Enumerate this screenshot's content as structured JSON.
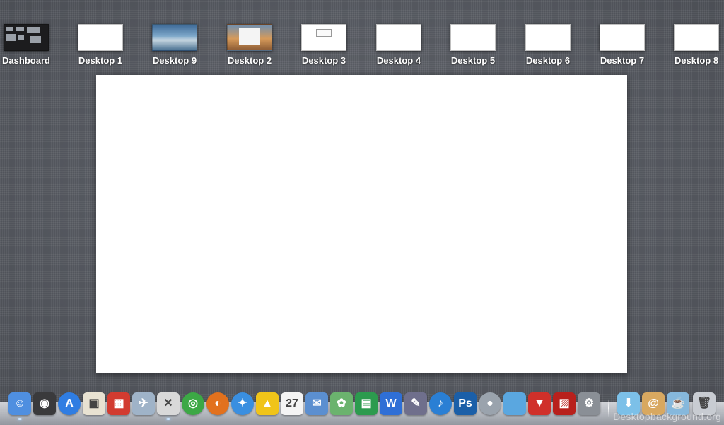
{
  "spaces": [
    {
      "label": "Dashboard",
      "kind": "dashboard"
    },
    {
      "label": "Desktop 1",
      "kind": "blank"
    },
    {
      "label": "Desktop 9",
      "kind": "sea-wallpaper"
    },
    {
      "label": "Desktop 2",
      "kind": "sunset-wallpaper-with-window"
    },
    {
      "label": "Desktop 3",
      "kind": "blank-with-window"
    },
    {
      "label": "Desktop 4",
      "kind": "blank"
    },
    {
      "label": "Desktop 5",
      "kind": "blank"
    },
    {
      "label": "Desktop 6",
      "kind": "blank"
    },
    {
      "label": "Desktop 7",
      "kind": "blank"
    },
    {
      "label": "Desktop 8",
      "kind": "blank"
    }
  ],
  "dock": {
    "apps": [
      {
        "icon": "finder-icon",
        "glyph": "☺",
        "color": "#4f8fe0"
      },
      {
        "icon": "dashboard-icon",
        "glyph": "◉",
        "color": "#3a3a3c"
      },
      {
        "icon": "app-store-icon",
        "glyph": "A",
        "color": "#2f7de2"
      },
      {
        "icon": "preview-icon",
        "glyph": "▣",
        "color": "#e8e2d2"
      },
      {
        "icon": "vmware-icon",
        "glyph": "▦",
        "color": "#d23b30"
      },
      {
        "icon": "network-icon",
        "glyph": "✈",
        "color": "#9fb3c8"
      },
      {
        "icon": "photo-booth-icon",
        "glyph": "✕",
        "color": "#d9d9d9"
      },
      {
        "icon": "chrome-icon",
        "glyph": "◎",
        "color": "#3ca845"
      },
      {
        "icon": "firefox-icon",
        "glyph": "◐",
        "color": "#e2711d"
      },
      {
        "icon": "safari-icon",
        "glyph": "✦",
        "color": "#3a8fe0"
      },
      {
        "icon": "twitter-client-icon",
        "glyph": "▲",
        "color": "#f0c419"
      },
      {
        "icon": "ical-icon",
        "glyph": "27",
        "color": "#f4f4f4"
      },
      {
        "icon": "mail-icon",
        "glyph": "✉",
        "color": "#5b8fd0"
      },
      {
        "icon": "image-editor-icon",
        "glyph": "✿",
        "color": "#6bb36e"
      },
      {
        "icon": "numbers-icon",
        "glyph": "▤",
        "color": "#2c9b4e"
      },
      {
        "icon": "word-icon",
        "glyph": "W",
        "color": "#2f6fd6"
      },
      {
        "icon": "pen-tool-icon",
        "glyph": "✎",
        "color": "#6f6f8c"
      },
      {
        "icon": "itunes-icon",
        "glyph": "♪",
        "color": "#2a7fd4"
      },
      {
        "icon": "photoshop-icon",
        "glyph": "Ps",
        "color": "#1b5fa8"
      },
      {
        "icon": "facetime-icon",
        "glyph": "●",
        "color": "#9aa3ad"
      },
      {
        "icon": "apple-remote-icon",
        "glyph": "",
        "color": "#5aa7e0"
      },
      {
        "icon": "chair-app-icon",
        "glyph": "▼",
        "color": "#d0302a"
      },
      {
        "icon": "photo-app-icon",
        "glyph": "▨",
        "color": "#b8201c"
      },
      {
        "icon": "system-preferences-icon",
        "glyph": "⚙",
        "color": "#8a8f96"
      }
    ],
    "stacks": [
      {
        "icon": "downloads-folder-icon",
        "glyph": "⬇",
        "color": "#7cc0e8"
      },
      {
        "icon": "documents-folder-icon",
        "glyph": "@",
        "color": "#d8a860"
      },
      {
        "icon": "applications-folder-icon",
        "glyph": "☕",
        "color": "#86b8dc"
      },
      {
        "icon": "trash-icon",
        "glyph": "🗑",
        "color": "#c8ccd2"
      }
    ]
  },
  "watermark": "Desktopbackground.org"
}
